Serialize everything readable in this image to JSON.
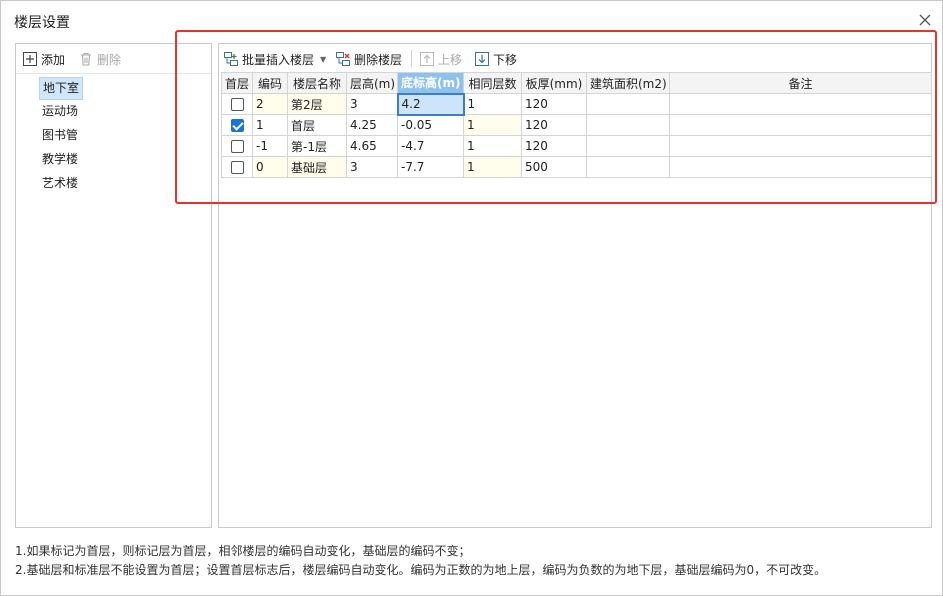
{
  "dialog": {
    "title": "楼层设置"
  },
  "left_toolbar": {
    "add_label": "添加",
    "delete_label": "删除"
  },
  "tree": {
    "items": [
      {
        "label": "地下室",
        "selected": true
      },
      {
        "label": "运动场",
        "selected": false
      },
      {
        "label": "图书管",
        "selected": false
      },
      {
        "label": "教学楼",
        "selected": false
      },
      {
        "label": "艺术楼",
        "selected": false
      }
    ]
  },
  "right_toolbar": {
    "batch_insert_label": "批量插入楼层",
    "delete_floor_label": "删除楼层",
    "move_up_label": "上移",
    "move_down_label": "下移"
  },
  "grid": {
    "headers": [
      "首层",
      "编码",
      "楼层名称",
      "层高(m)",
      "底标高(m)",
      "相同层数",
      "板厚(mm)",
      "建筑面积(m2)",
      "备注"
    ],
    "active_column": "底标高(m)",
    "rows": [
      {
        "is_first": false,
        "code": "2",
        "name": "第2层",
        "height": "3",
        "base_elev": "4.2",
        "same_count": "1",
        "slab": "120",
        "area": "",
        "note": ""
      },
      {
        "is_first": true,
        "code": "1",
        "name": "首层",
        "height": "4.25",
        "base_elev": "-0.05",
        "same_count": "1",
        "slab": "120",
        "area": "",
        "note": ""
      },
      {
        "is_first": false,
        "code": "-1",
        "name": "第-1层",
        "height": "4.65",
        "base_elev": "-4.7",
        "same_count": "1",
        "slab": "120",
        "area": "",
        "note": ""
      },
      {
        "is_first": false,
        "code": "0",
        "name": "基础层",
        "height": "3",
        "base_elev": "-7.7",
        "same_count": "1",
        "slab": "500",
        "area": "",
        "note": ""
      }
    ]
  },
  "notes": {
    "line1": "1.如果标记为首层，则标记层为首层，相邻楼层的编码自动变化，基础层的编码不变；",
    "line2": "2.基础层和标准层不能设置为首层；设置首层标志后，楼层编码自动变化。编码为正数的为地上层，编码为负数的为地下层，基础层编码为0，不可改变。"
  },
  "colors": {
    "highlight": "#e3342f",
    "selection": "#cfe6fb",
    "active_header": "#8ec2ee",
    "checkbox": "#1a73d9"
  }
}
